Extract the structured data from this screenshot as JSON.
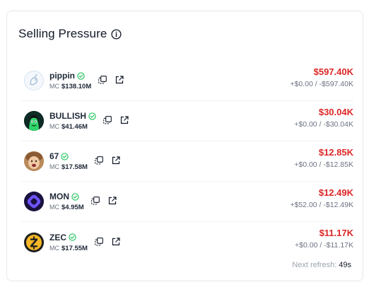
{
  "panel": {
    "title": "Selling Pressure",
    "info_icon": "info-circle-icon"
  },
  "tokens": [
    {
      "name": "pippin",
      "verified": true,
      "mc_label": "MC",
      "mc_value": "$138.10M",
      "amount": "$597.40K",
      "detail": "+$0.00 / -$597.40K",
      "avatar_icon": "pippin-unicorn-avatar"
    },
    {
      "name": "BULLISH",
      "verified": true,
      "mc_label": "MC",
      "mc_value": "$41.46M",
      "amount": "$30.04K",
      "detail": "+$0.00 / -$30.04K",
      "avatar_icon": "bullish-green-character-avatar"
    },
    {
      "name": "67",
      "verified": true,
      "mc_label": "MC",
      "mc_value": "$17.58M",
      "amount": "$12.85K",
      "detail": "+$0.00 / -$12.85K",
      "avatar_icon": "67-kid-face-avatar"
    },
    {
      "name": "MON",
      "verified": true,
      "mc_label": "MC",
      "mc_value": "$4.95M",
      "amount": "$12.49K",
      "detail": "+$52.00 / -$12.49K",
      "avatar_icon": "mon-purple-logo-avatar"
    },
    {
      "name": "ZEC",
      "verified": true,
      "mc_label": "MC",
      "mc_value": "$17.55M",
      "amount": "$11.17K",
      "detail": "+$0.00 / -$11.17K",
      "avatar_icon": "zec-zcash-logo-avatar"
    }
  ],
  "footer": {
    "label": "Next refresh:",
    "value": "49s"
  },
  "colors": {
    "sell_red": "#dc2626",
    "verified_green": "#22c55e",
    "muted_text": "#6b7280"
  }
}
